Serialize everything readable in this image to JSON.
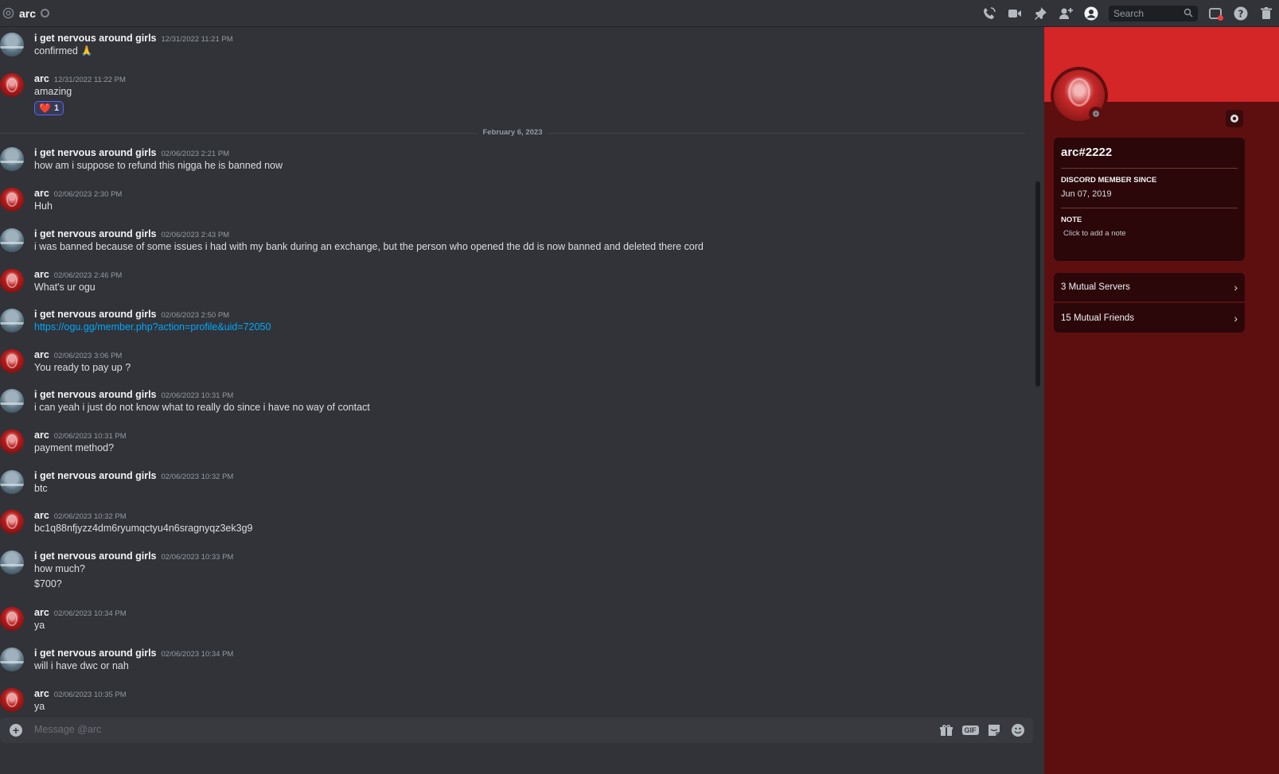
{
  "topbar": {
    "dm_name": "arc",
    "search_placeholder": "Search",
    "icons": [
      "voice-call-icon",
      "video-call-icon",
      "pinned-messages-icon",
      "add-friends-icon",
      "user-profile-icon",
      "inbox-icon",
      "help-icon",
      "trash-icon"
    ]
  },
  "divider": {
    "label": "February 6, 2023"
  },
  "messages": [
    {
      "author": "i get nervous around girls",
      "ts": "12/31/2022 11:21 PM",
      "text": "confirmed 🙏",
      "avatar": "sea"
    },
    {
      "author": "arc",
      "ts": "12/31/2022 11:22 PM",
      "text": "amazing",
      "avatar": "red",
      "reaction": {
        "emoji": "❤️",
        "count": "1"
      }
    },
    {
      "author": "i get nervous around girls",
      "ts": "02/06/2023 2:21 PM",
      "text": "how am i suppose to refund this nigga he is banned now",
      "avatar": "sea"
    },
    {
      "author": "arc",
      "ts": "02/06/2023 2:30 PM",
      "text": "Huh",
      "avatar": "red"
    },
    {
      "author": "i get nervous around girls",
      "ts": "02/06/2023 2:43 PM",
      "text": "i was banned because of some issues i had with my bank during an exchange, but the person who opened the dd is now banned and deleted there cord",
      "avatar": "sea"
    },
    {
      "author": "arc",
      "ts": "02/06/2023 2:46 PM",
      "text": "What's ur ogu",
      "avatar": "red"
    },
    {
      "author": "i get nervous around girls",
      "ts": "02/06/2023 2:50 PM",
      "text": "https://ogu.gg/member.php?action=profile&uid=72050",
      "avatar": "sea",
      "is_link": true
    },
    {
      "author": "arc",
      "ts": "02/06/2023 3:06 PM",
      "text": "You ready to pay up ?",
      "avatar": "red"
    },
    {
      "author": "i get nervous around girls",
      "ts": "02/06/2023 10:31 PM",
      "text": "i can yeah i just do not know what to really do since i have no way of contact",
      "avatar": "sea"
    },
    {
      "author": "arc",
      "ts": "02/06/2023 10:31 PM",
      "text": "payment method?",
      "avatar": "red"
    },
    {
      "author": "i get nervous around girls",
      "ts": "02/06/2023 10:32 PM",
      "text": "btc",
      "avatar": "sea"
    },
    {
      "author": "arc",
      "ts": "02/06/2023 10:32 PM",
      "text": "bc1q88nfjyzz4dm6ryumqctyu4n6sragnyqz3ek3g9",
      "avatar": "red"
    },
    {
      "author": "i get nervous around girls",
      "ts": "02/06/2023 10:33 PM",
      "text": "how much?",
      "text2": "$700?",
      "avatar": "sea"
    },
    {
      "author": "arc",
      "ts": "02/06/2023 10:34 PM",
      "text": "ya",
      "avatar": "red"
    },
    {
      "author": "i get nervous around girls",
      "ts": "02/06/2023 10:34 PM",
      "text": "will i have dwc or nah",
      "avatar": "sea"
    },
    {
      "author": "arc",
      "ts": "02/06/2023 10:35 PM",
      "text": "ya",
      "avatar": "red"
    }
  ],
  "composer": {
    "placeholder": "Message @arc",
    "gif_label": "GIF"
  },
  "profile": {
    "username": "arc#2222",
    "member_since_label": "DISCORD MEMBER SINCE",
    "member_since": "Jun 07, 2019",
    "note_label": "NOTE",
    "note_placeholder": "Click to add a note",
    "mutual_servers": "3 Mutual Servers",
    "mutual_friends": "15 Mutual Friends",
    "banner_color": "#d42527"
  }
}
